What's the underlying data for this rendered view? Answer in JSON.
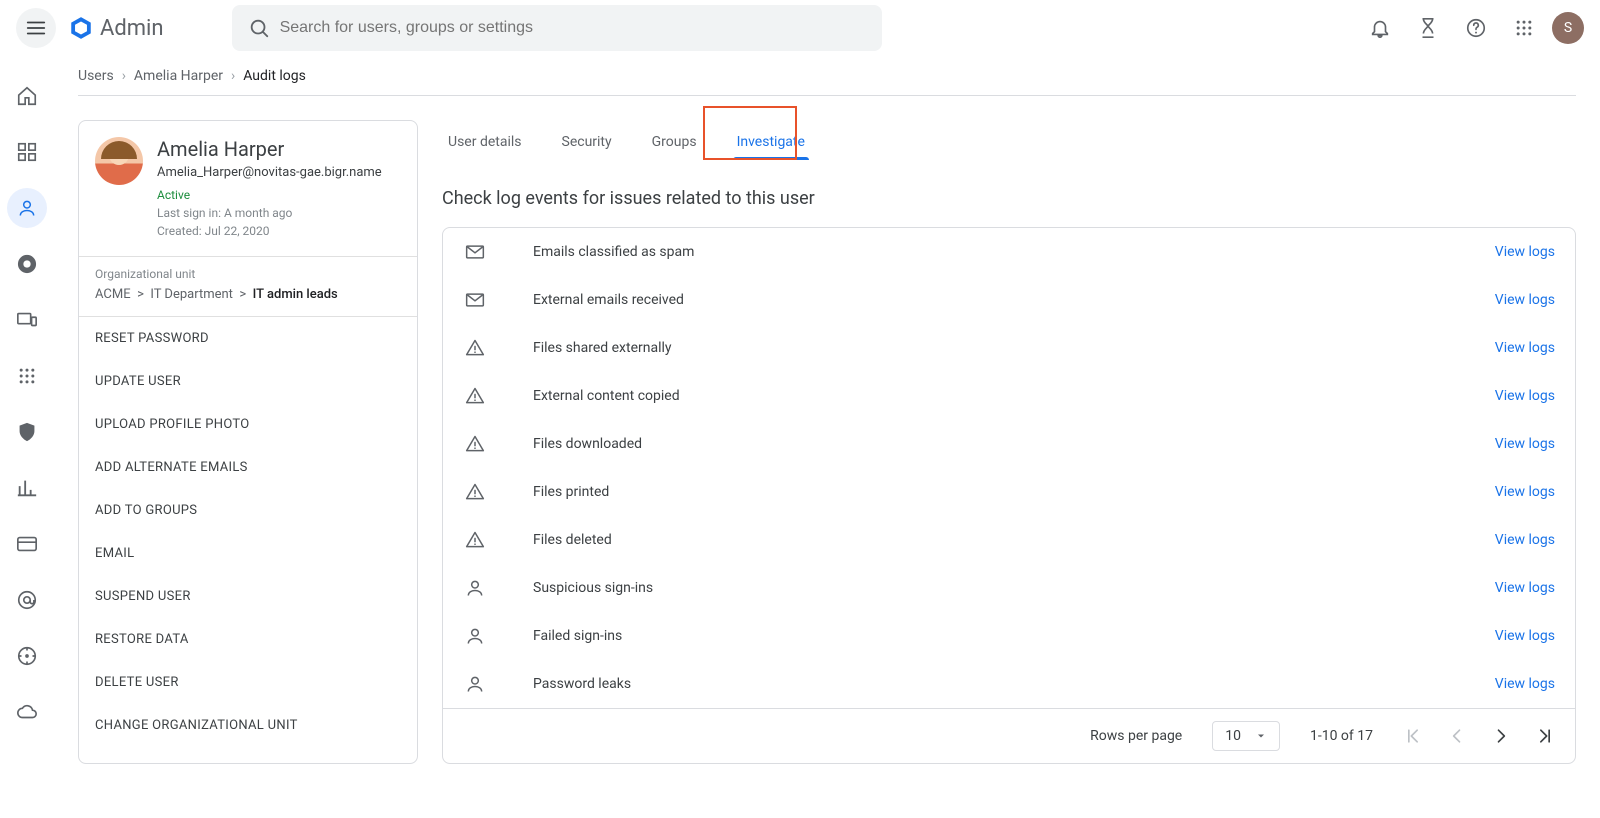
{
  "header": {
    "app_name": "Admin",
    "search_placeholder": "Search for users, groups or settings",
    "avatar_initial": "S"
  },
  "breadcrumb": {
    "items": [
      "Users",
      "Amelia Harper"
    ],
    "current": "Audit logs"
  },
  "user": {
    "name": "Amelia Harper",
    "email": "Amelia_Harper@novitas-gae.bigr.name",
    "status": "Active",
    "last_signin": "Last sign in: A month ago",
    "created": "Created: Jul 22, 2020",
    "org_label": "Organizational unit",
    "org_path": [
      "ACME",
      "IT Department"
    ],
    "org_leaf": "IT admin leads",
    "actions": [
      "RESET PASSWORD",
      "UPDATE USER",
      "UPLOAD PROFILE PHOTO",
      "ADD ALTERNATE EMAILS",
      "ADD TO GROUPS",
      "EMAIL",
      "SUSPEND USER",
      "RESTORE DATA",
      "DELETE USER",
      "CHANGE ORGANIZATIONAL UNIT"
    ]
  },
  "tabs": [
    "User details",
    "Security",
    "Groups",
    "Investigate"
  ],
  "active_tab": "Investigate",
  "panel": {
    "heading": "Check log events for issues related to this user",
    "view_logs_label": "View logs",
    "rows": [
      {
        "icon": "gmail",
        "label": "Emails classified as spam"
      },
      {
        "icon": "gmail",
        "label": "External emails received"
      },
      {
        "icon": "drive-alert",
        "label": "Files shared externally"
      },
      {
        "icon": "drive-alert",
        "label": "External content copied"
      },
      {
        "icon": "drive-alert",
        "label": "Files downloaded"
      },
      {
        "icon": "drive-alert",
        "label": "Files printed"
      },
      {
        "icon": "drive-alert",
        "label": "Files deleted"
      },
      {
        "icon": "person",
        "label": "Suspicious sign-ins"
      },
      {
        "icon": "person",
        "label": "Failed sign-ins"
      },
      {
        "icon": "person",
        "label": "Password leaks"
      }
    ]
  },
  "pager": {
    "rows_per_page_label": "Rows per page",
    "page_size": "10",
    "range": "1-10 of 17"
  }
}
